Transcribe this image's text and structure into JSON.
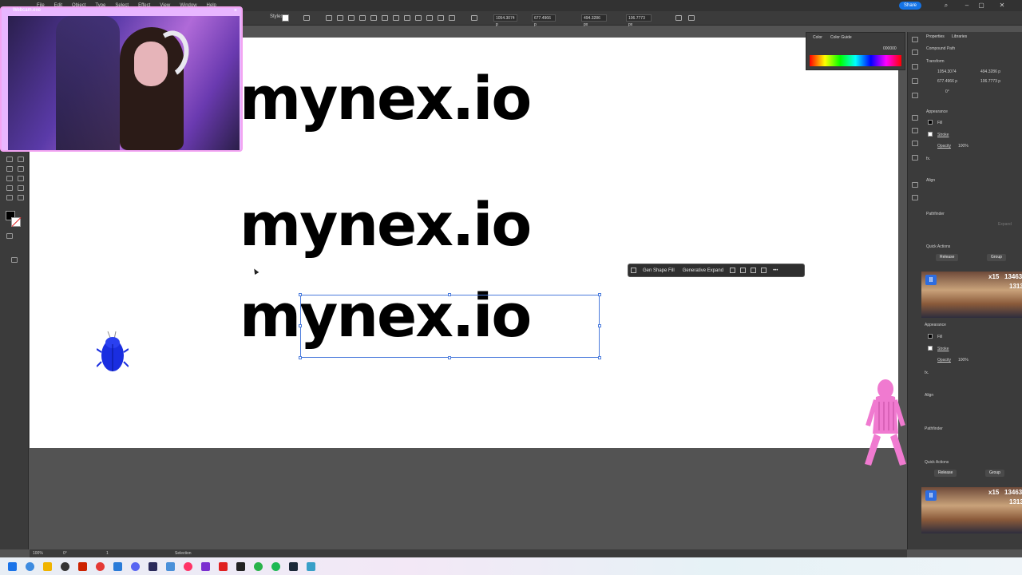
{
  "menu": {
    "items": [
      "Webcam.exe",
      "File",
      "Edit",
      "Object",
      "Type",
      "Select",
      "Effect",
      "View",
      "Window",
      "Help"
    ],
    "share_label": "Share"
  },
  "control_bar": {
    "style_label": "Styles",
    "x_value": "1054.3074 p",
    "y_value": "677.4966 p",
    "w_value": "494.3286 px",
    "h_value": "106.7773 px"
  },
  "webcam": {
    "title": "Webcam.exe",
    "close": "×"
  },
  "artboard": {
    "logo_1": "mynex.io",
    "logo_2": "mynex.io",
    "logo_3": "mynex.io"
  },
  "context_bar": {
    "gen_shape_fill": "Gen Shape Fill",
    "generative_expand": "Generative Expand"
  },
  "color_panel": {
    "tab_color": "Color",
    "tab_guide": "Color Guide",
    "hex": "000000"
  },
  "properties": {
    "tab_properties": "Properties",
    "tab_libraries": "Libraries",
    "object_type": "Compound Path",
    "transform": "Transform",
    "x": "1054.3074",
    "y": "677.4966 p",
    "w": "494.3286 p",
    "h": "106.7773 p",
    "angle": "0°",
    "appearance": "Appearance",
    "fill": "Fill",
    "stroke": "Stroke",
    "opacity": "Opacity",
    "opacity_value": "100%",
    "fx": "fx.",
    "align": "Align",
    "pathfinder": "Pathfinder",
    "expand": "Expand",
    "quick_actions": "Quick Actions",
    "release": "Release",
    "group": "Group"
  },
  "overlay": {
    "pause": "II",
    "multiplier": "x15",
    "score_1": "13463",
    "score_2": "1313"
  },
  "statusbar": {
    "zoom": "100%",
    "rotate": "0°",
    "page": "1",
    "tool": "Selection"
  },
  "colors": {
    "accent": "#1473e6",
    "selection": "#4a7bdc",
    "beetle": "#1a2ee0",
    "pink": "#f07ad0",
    "webcam_border": "#f2a4f2"
  }
}
